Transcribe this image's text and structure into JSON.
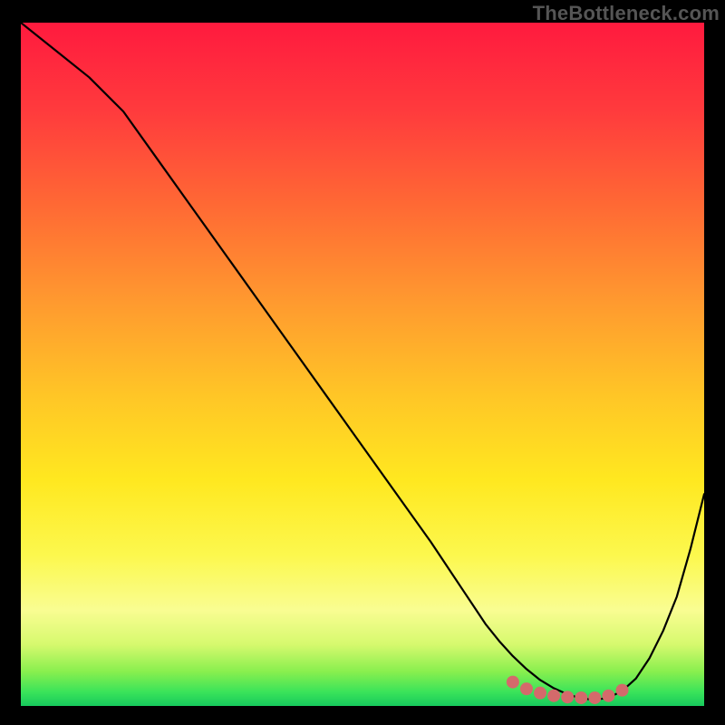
{
  "watermark": "TheBottleneck.com",
  "chart_data": {
    "type": "line",
    "title": "",
    "xlabel": "",
    "ylabel": "",
    "x_range": [
      0,
      100
    ],
    "y_range": [
      0,
      100
    ],
    "grid": false,
    "background_gradient": {
      "direction": "vertical",
      "stops": [
        {
          "pos": 0.0,
          "color": "#ff1a3e"
        },
        {
          "pos": 0.13,
          "color": "#ff3b3d"
        },
        {
          "pos": 0.27,
          "color": "#ff6a34"
        },
        {
          "pos": 0.41,
          "color": "#ff9a2f"
        },
        {
          "pos": 0.55,
          "color": "#ffc726"
        },
        {
          "pos": 0.67,
          "color": "#ffe820"
        },
        {
          "pos": 0.78,
          "color": "#fcf84e"
        },
        {
          "pos": 0.86,
          "color": "#f9fd92"
        },
        {
          "pos": 0.91,
          "color": "#d6f96e"
        },
        {
          "pos": 0.95,
          "color": "#88ef4e"
        },
        {
          "pos": 0.98,
          "color": "#39e35a"
        },
        {
          "pos": 1.0,
          "color": "#17c95c"
        }
      ]
    },
    "series": [
      {
        "name": "bottleneck-curve",
        "color": "#000000",
        "x": [
          0,
          5,
          10,
          15,
          20,
          25,
          30,
          35,
          40,
          45,
          50,
          55,
          60,
          62,
          64,
          66,
          68,
          70,
          72,
          74,
          76,
          78,
          80,
          82,
          84,
          86,
          88,
          90,
          92,
          94,
          96,
          98,
          100
        ],
        "y": [
          100,
          96,
          92,
          87,
          80,
          73,
          66,
          59,
          52,
          45,
          38,
          31,
          24,
          21,
          18,
          15,
          12,
          9.5,
          7.3,
          5.4,
          3.8,
          2.6,
          1.7,
          1.1,
          0.9,
          1.2,
          2.2,
          4.0,
          7.0,
          11,
          16,
          23,
          31
        ]
      }
    ],
    "markers": {
      "name": "optimal-range-dots",
      "color": "#d46a6b",
      "points": [
        {
          "x": 72,
          "y": 3.5
        },
        {
          "x": 74,
          "y": 2.5
        },
        {
          "x": 76,
          "y": 1.9
        },
        {
          "x": 78,
          "y": 1.5
        },
        {
          "x": 80,
          "y": 1.3
        },
        {
          "x": 82,
          "y": 1.2
        },
        {
          "x": 84,
          "y": 1.2
        },
        {
          "x": 86,
          "y": 1.5
        },
        {
          "x": 88,
          "y": 2.3
        }
      ]
    }
  }
}
